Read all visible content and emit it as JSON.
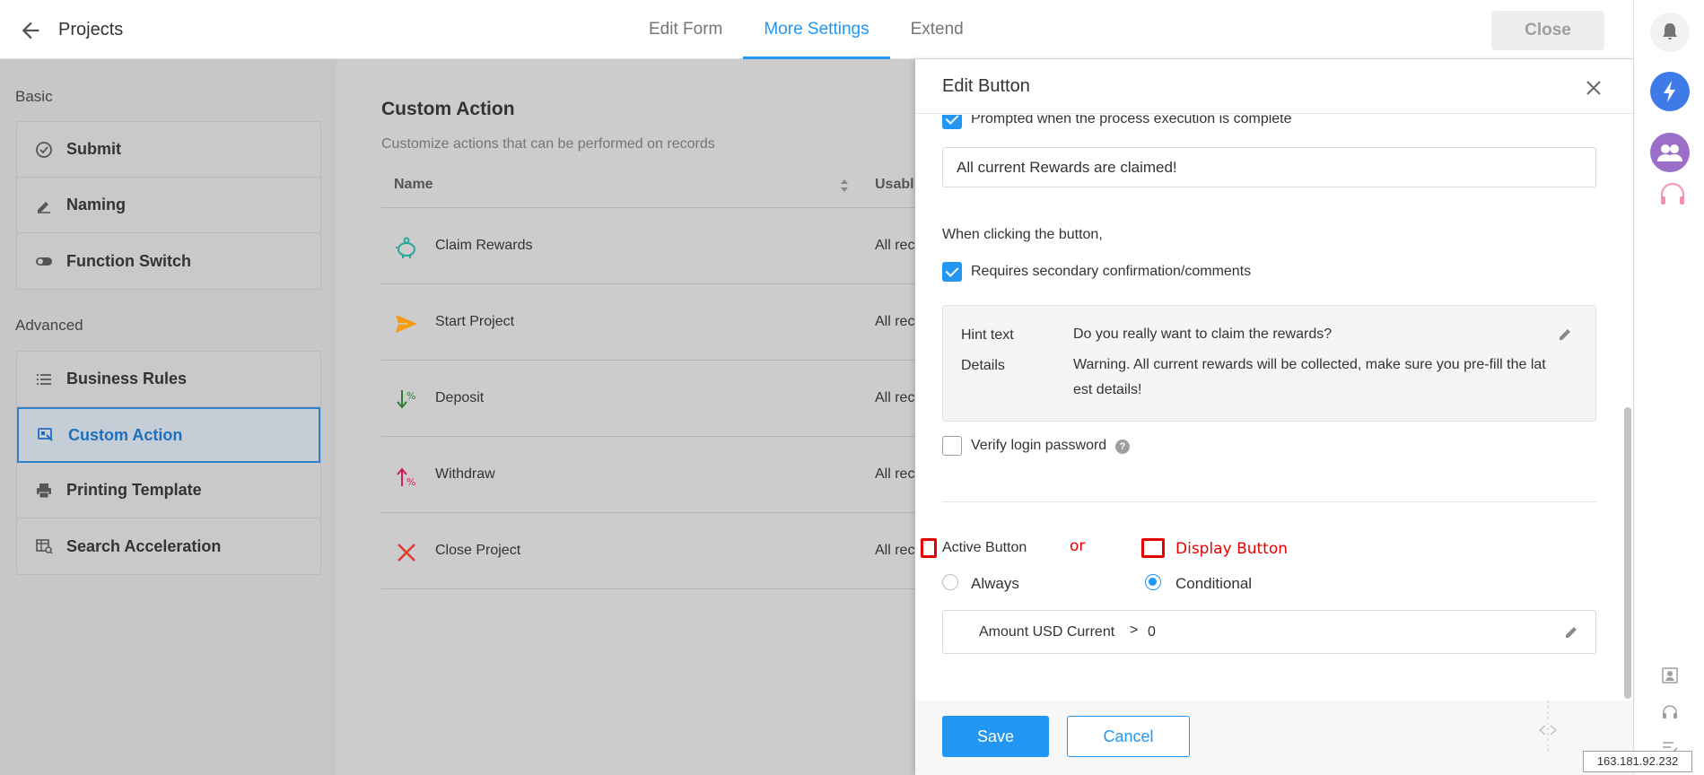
{
  "header": {
    "title": "Projects",
    "tabs": [
      {
        "label": "Edit Form"
      },
      {
        "label": "More Settings"
      },
      {
        "label": "Extend"
      }
    ],
    "close_label": "Close"
  },
  "sidebar": {
    "basic_label": "Basic",
    "advanced_label": "Advanced",
    "basic_items": [
      {
        "label": "Submit",
        "icon": "check-circle-icon"
      },
      {
        "label": "Naming",
        "icon": "pen-icon"
      },
      {
        "label": "Function Switch",
        "icon": "toggle-icon"
      }
    ],
    "advanced_items": [
      {
        "label": "Business Rules",
        "icon": "list-icon"
      },
      {
        "label": "Custom Action",
        "icon": "custom-action-icon"
      },
      {
        "label": "Printing Template",
        "icon": "printer-icon"
      },
      {
        "label": "Search Acceleration",
        "icon": "search-table-icon"
      }
    ]
  },
  "main": {
    "title": "Custom Action",
    "subtitle": "Customize actions that can be performed on records",
    "columns": {
      "name": "Name",
      "usable": "Usabl"
    },
    "rows": [
      {
        "name": "Claim Rewards",
        "usable": "All rec",
        "icon": "piggy-bank-icon",
        "color": "#26a69a"
      },
      {
        "name": "Start Project",
        "usable": "All rec",
        "icon": "send-icon",
        "color": "#f39c12"
      },
      {
        "name": "Deposit",
        "usable": "All rec",
        "icon": "deposit-icon",
        "color": "#2e7d32"
      },
      {
        "name": "Withdraw",
        "usable": "All rec",
        "icon": "withdraw-icon",
        "color": "#d81b60"
      },
      {
        "name": "Close Project",
        "usable": "All rec",
        "icon": "x-icon",
        "color": "#e53935"
      }
    ]
  },
  "panel": {
    "title": "Edit Button",
    "prompt_checkbox_label": "Prompted when the process execution is complete",
    "prompt_message": "All current Rewards are claimed!",
    "when_clicking": "When clicking the button,",
    "confirm_checkbox_label": "Requires secondary confirmation/comments",
    "hint_text_label": "Hint text",
    "hint_text_value": "Do you really want to claim the rewards?",
    "details_label": "Details",
    "details_value": "Warning. All current rewards will be collected, make sure you pre-fill the lat est details!",
    "verify_label": "Verify login password",
    "active_button_label": "Active Button",
    "or_label": "or",
    "display_button_label": "Display Button",
    "always_label": "Always",
    "conditional_label": "Conditional",
    "condition": {
      "field": "Amount USD Current",
      "operator": ">",
      "value": "0"
    },
    "save_label": "Save",
    "cancel_label": "Cancel"
  },
  "ip_address": "163.181.92.232",
  "colors": {
    "accent": "#2196f3",
    "annotation": "#e60000"
  }
}
